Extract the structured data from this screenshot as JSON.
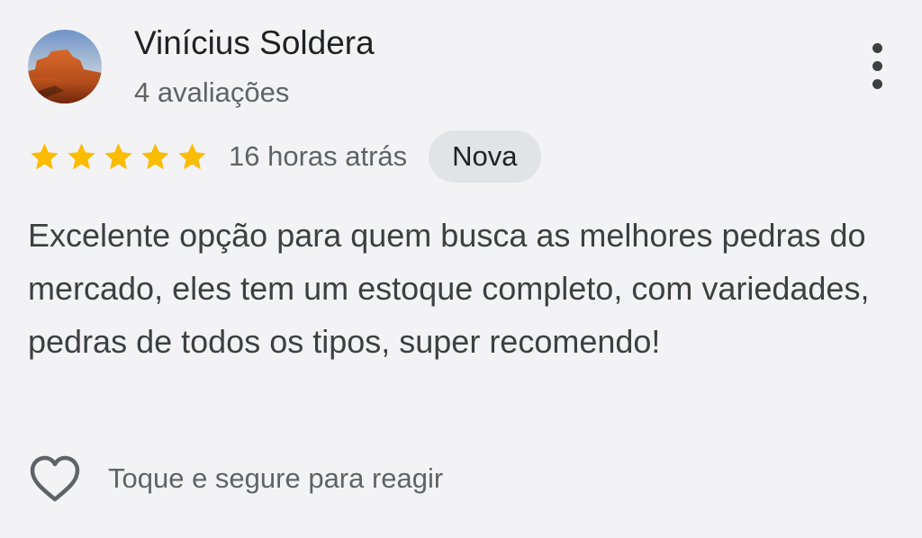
{
  "reviewer": {
    "name": "Vinícius Soldera",
    "reviews_count": "4 avaliações"
  },
  "rating": {
    "stars": 5,
    "max_stars": 5,
    "star_color": "#fbbc04",
    "time": "16 horas atrás",
    "badge": "Nova"
  },
  "review": {
    "text": "Excelente opção para quem busca as melhores pedras do mercado, eles tem um estoque completo, com variedades, pedras de todos os tipos, super recomendo!"
  },
  "reaction": {
    "icon": "heart-outline-icon",
    "label": "Toque e segure para reagir"
  },
  "icons": {
    "menu": "more-vert-icon",
    "star": "star-icon"
  },
  "colors": {
    "background": "#f3f3f6",
    "badge_bg": "#e1e3e6",
    "text_primary": "#202124",
    "text_secondary": "#5f6368"
  }
}
